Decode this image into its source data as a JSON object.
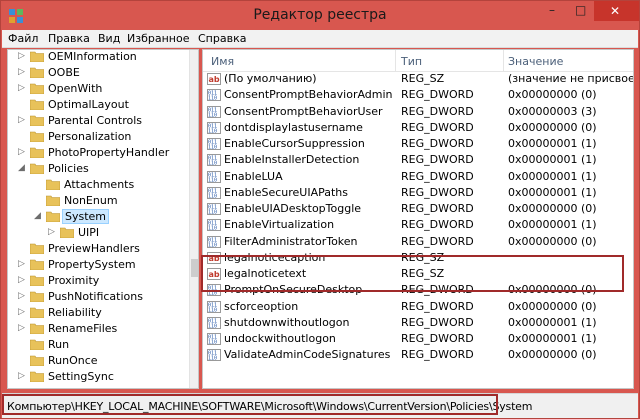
{
  "window": {
    "title": "Редактор реестра",
    "min_glyph": "–",
    "max_glyph": "□",
    "close_glyph": "✕"
  },
  "menu": [
    "Файл",
    "Правка",
    "Вид",
    "Избранное",
    "Справка"
  ],
  "tree": [
    {
      "label": "OEMInformation",
      "level": 1,
      "expander": "▷"
    },
    {
      "label": "OOBE",
      "level": 1,
      "expander": "▷"
    },
    {
      "label": "OpenWith",
      "level": 1,
      "expander": "▷"
    },
    {
      "label": "OptimalLayout",
      "level": 1,
      "expander": ""
    },
    {
      "label": "Parental Controls",
      "level": 1,
      "expander": "▷"
    },
    {
      "label": "Personalization",
      "level": 1,
      "expander": ""
    },
    {
      "label": "PhotoPropertyHandler",
      "level": 1,
      "expander": "▷"
    },
    {
      "label": "Policies",
      "level": 1,
      "expander": "◢"
    },
    {
      "label": "Attachments",
      "level": 2,
      "expander": ""
    },
    {
      "label": "NonEnum",
      "level": 2,
      "expander": ""
    },
    {
      "label": "System",
      "level": 2,
      "expander": "◢",
      "selected": true
    },
    {
      "label": "UIPI",
      "level": 3,
      "expander": "▷"
    },
    {
      "label": "PreviewHandlers",
      "level": 1,
      "expander": ""
    },
    {
      "label": "PropertySystem",
      "level": 1,
      "expander": "▷"
    },
    {
      "label": "Proximity",
      "level": 1,
      "expander": "▷"
    },
    {
      "label": "PushNotifications",
      "level": 1,
      "expander": "▷"
    },
    {
      "label": "Reliability",
      "level": 1,
      "expander": "▷"
    },
    {
      "label": "RenameFiles",
      "level": 1,
      "expander": "▷"
    },
    {
      "label": "Run",
      "level": 1,
      "expander": ""
    },
    {
      "label": "RunOnce",
      "level": 1,
      "expander": ""
    },
    {
      "label": "SettingSync",
      "level": 1,
      "expander": "▷"
    }
  ],
  "columns": {
    "name": "Имя",
    "type": "Тип",
    "value": "Значение"
  },
  "values": [
    {
      "icon": "string",
      "name": "(По умолчанию)",
      "type": "REG_SZ",
      "value": "(значение не присвоено)"
    },
    {
      "icon": "dword",
      "name": "ConsentPromptBehaviorAdmin",
      "type": "REG_DWORD",
      "value": "0x00000000 (0)"
    },
    {
      "icon": "dword",
      "name": "ConsentPromptBehaviorUser",
      "type": "REG_DWORD",
      "value": "0x00000003 (3)"
    },
    {
      "icon": "dword",
      "name": "dontdisplaylastusername",
      "type": "REG_DWORD",
      "value": "0x00000000 (0)"
    },
    {
      "icon": "dword",
      "name": "EnableCursorSuppression",
      "type": "REG_DWORD",
      "value": "0x00000001 (1)"
    },
    {
      "icon": "dword",
      "name": "EnableInstallerDetection",
      "type": "REG_DWORD",
      "value": "0x00000001 (1)"
    },
    {
      "icon": "dword",
      "name": "EnableLUA",
      "type": "REG_DWORD",
      "value": "0x00000001 (1)"
    },
    {
      "icon": "dword",
      "name": "EnableSecureUIAPaths",
      "type": "REG_DWORD",
      "value": "0x00000001 (1)"
    },
    {
      "icon": "dword",
      "name": "EnableUIADesktopToggle",
      "type": "REG_DWORD",
      "value": "0x00000000 (0)"
    },
    {
      "icon": "dword",
      "name": "EnableVirtualization",
      "type": "REG_DWORD",
      "value": "0x00000001 (1)"
    },
    {
      "icon": "dword",
      "name": "FilterAdministratorToken",
      "type": "REG_DWORD",
      "value": "0x00000000 (0)"
    },
    {
      "icon": "string",
      "name": "legalnoticecaption",
      "type": "REG_SZ",
      "value": ""
    },
    {
      "icon": "string",
      "name": "legalnoticetext",
      "type": "REG_SZ",
      "value": ""
    },
    {
      "icon": "dword",
      "name": "PromptOnSecureDesktop",
      "type": "REG_DWORD",
      "value": "0x00000000 (0)"
    },
    {
      "icon": "dword",
      "name": "scforceoption",
      "type": "REG_DWORD",
      "value": "0x00000000 (0)"
    },
    {
      "icon": "dword",
      "name": "shutdownwithoutlogon",
      "type": "REG_DWORD",
      "value": "0x00000001 (1)"
    },
    {
      "icon": "dword",
      "name": "undockwithoutlogon",
      "type": "REG_DWORD",
      "value": "0x00000001 (1)"
    },
    {
      "icon": "dword",
      "name": "ValidateAdminCodeSignatures",
      "type": "REG_DWORD",
      "value": "0x00000000 (0)"
    }
  ],
  "status": {
    "path": "Компьютер\\HKEY_LOCAL_MACHINE\\SOFTWARE\\Microsoft\\Windows\\CurrentVersion\\Policies\\System"
  },
  "colors": {
    "titlebar": "#d8574f",
    "close_button": "#c7342b",
    "highlight_frame": "#a02a2a",
    "selection": "#cce8ff",
    "folder": "#e8c25a"
  }
}
